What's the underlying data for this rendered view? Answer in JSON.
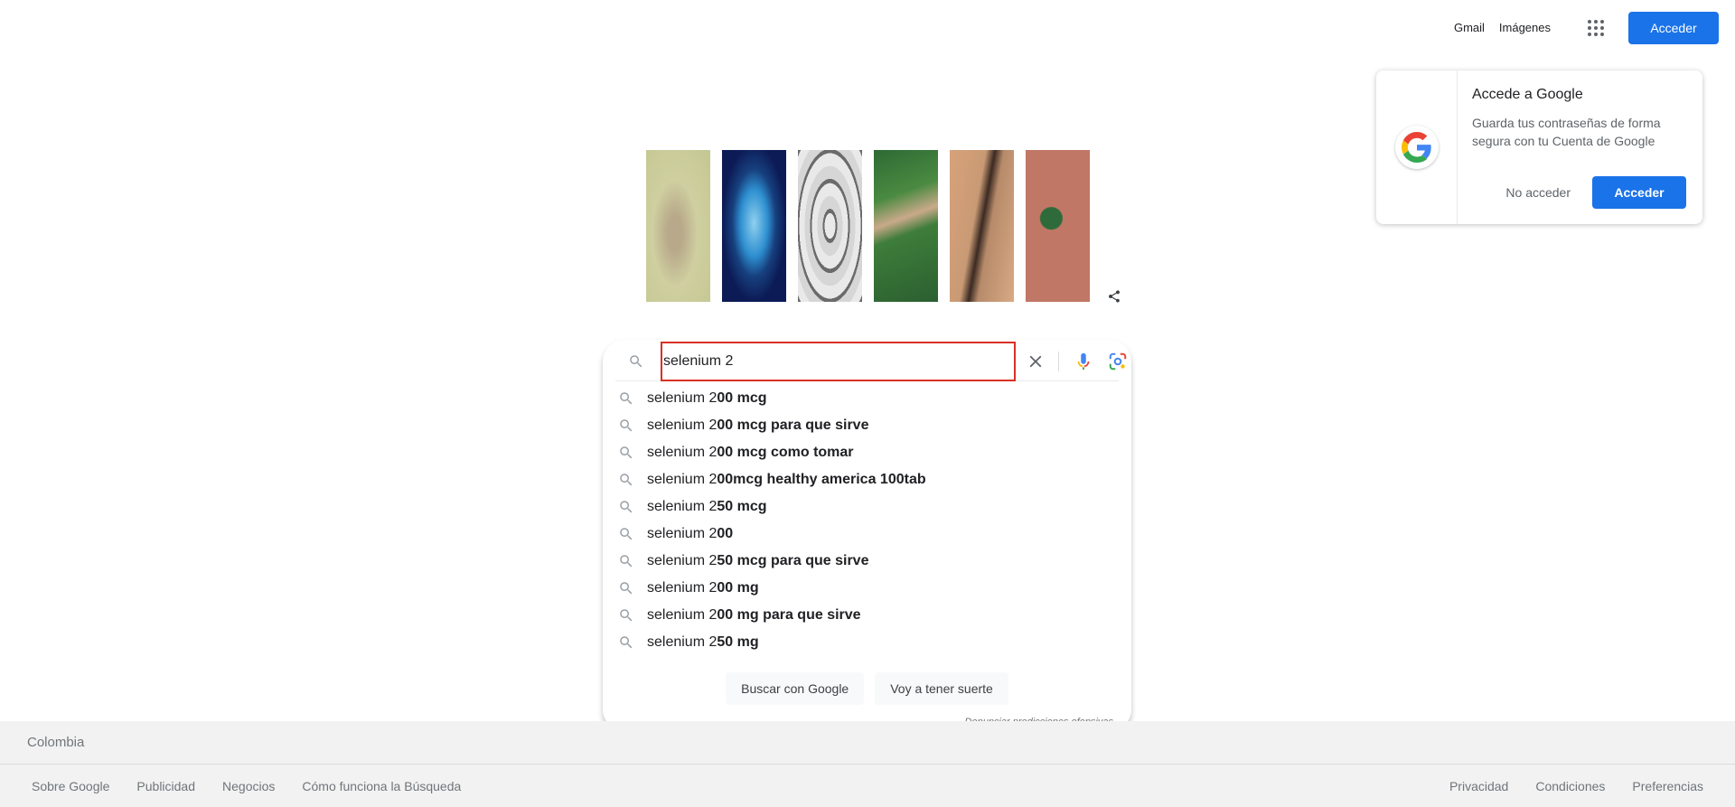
{
  "header": {
    "gmail_label": "Gmail",
    "images_label": "Imágenes",
    "apps_icon": "apps-grid-icon",
    "signin_label": "Acceder"
  },
  "promo": {
    "title": "Accede a Google",
    "text": "Guarda tus contraseñas de forma segura con tu Cuenta de Google",
    "decline_label": "No acceder",
    "accept_label": "Acceder"
  },
  "doodle": {
    "share_icon": "share-icon"
  },
  "search": {
    "value": "selenium 2",
    "suggestions": [
      {
        "typed": "selenium 2",
        "completion": "00 mcg"
      },
      {
        "typed": "selenium 2",
        "completion": "00 mcg para que sirve"
      },
      {
        "typed": "selenium 2",
        "completion": "00 mcg como tomar"
      },
      {
        "typed": "selenium 2",
        "completion": "00mcg healthy america 100tab"
      },
      {
        "typed": "selenium 2",
        "completion": "50 mcg"
      },
      {
        "typed": "selenium 2",
        "completion": "00"
      },
      {
        "typed": "selenium 2",
        "completion": "50 mcg para que sirve"
      },
      {
        "typed": "selenium 2",
        "completion": "00 mg"
      },
      {
        "typed": "selenium 2",
        "completion": "00 mg para que sirve"
      },
      {
        "typed": "selenium 2",
        "completion": "50 mg"
      }
    ],
    "search_button_label": "Buscar con Google",
    "lucky_button_label": "Voy a tener suerte",
    "report_label": "Denunciar predicciones ofensivas"
  },
  "footer": {
    "country": "Colombia",
    "left_links": [
      "Sobre Google",
      "Publicidad",
      "Negocios",
      "Cómo funciona la Búsqueda"
    ],
    "right_links": [
      "Privacidad",
      "Condiciones",
      "Preferencias"
    ]
  },
  "colors": {
    "accent": "#1a73e8",
    "focus_outline": "#d93025",
    "footer_bg": "#f2f2f2"
  }
}
